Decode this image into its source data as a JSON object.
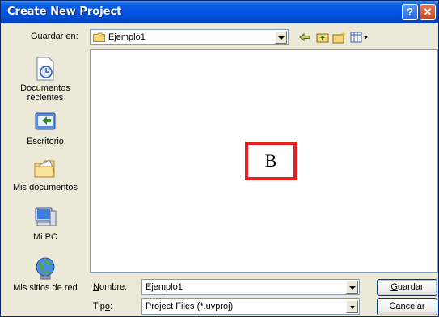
{
  "window": {
    "title": "Create New Project",
    "help": "?",
    "close": "✕"
  },
  "lookin": {
    "label_pre": "Guar",
    "label_u": "d",
    "label_post": "ar en:",
    "value": "Ejemplo1"
  },
  "places": [
    {
      "label": "Documentos recientes",
      "icon": "recent-documents-icon"
    },
    {
      "label": "Escritorio",
      "icon": "desktop-icon"
    },
    {
      "label": "Mis documentos",
      "icon": "my-documents-icon"
    },
    {
      "label": "Mi PC",
      "icon": "my-computer-icon"
    },
    {
      "label": "Mis sitios de red",
      "icon": "network-places-icon"
    }
  ],
  "overlay": {
    "text": "B",
    "color": "#e5211f"
  },
  "name_field": {
    "label_u": "N",
    "label_post": "ombre:",
    "value": "Ejemplo1"
  },
  "type_field": {
    "label_pre": "Tip",
    "label_u": "o",
    "label_post": ":",
    "value": "Project Files (*.uvproj)"
  },
  "buttons": {
    "save_u": "G",
    "save_post": "uardar",
    "cancel": "Cancelar"
  }
}
